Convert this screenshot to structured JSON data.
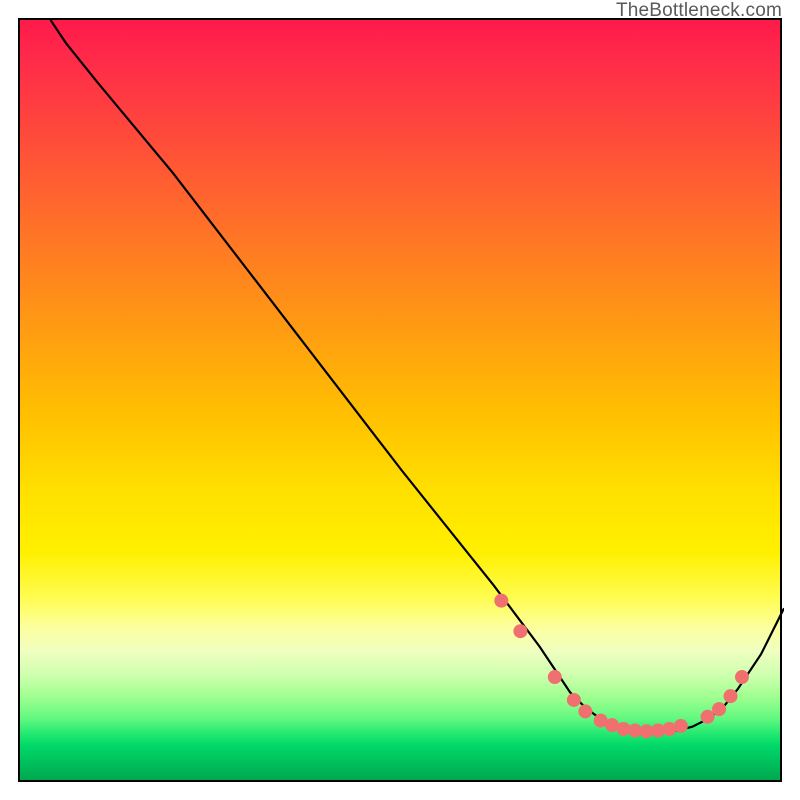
{
  "watermark": "TheBottleneck.com",
  "chart_data": {
    "type": "line",
    "title": "",
    "xlabel": "",
    "ylabel": "",
    "xlim": [
      0,
      100
    ],
    "ylim": [
      0,
      100
    ],
    "series": [
      {
        "name": "curve",
        "x": [
          4,
          6,
          10,
          20,
          30,
          40,
          50,
          58,
          62,
          65,
          68,
          70,
          72,
          74,
          76,
          78,
          80,
          82,
          84,
          86,
          88,
          90,
          92,
          94,
          97,
          100
        ],
        "values": [
          100,
          97,
          92,
          80,
          67,
          54,
          41,
          31,
          26,
          22,
          18,
          15,
          12,
          10,
          8.5,
          7.5,
          7,
          6.8,
          6.8,
          7,
          7.5,
          8.5,
          10,
          12.5,
          17,
          23
        ]
      }
    ],
    "markers": [
      {
        "x": 63,
        "y": 24
      },
      {
        "x": 65.5,
        "y": 20
      },
      {
        "x": 70,
        "y": 14
      },
      {
        "x": 72.5,
        "y": 11
      },
      {
        "x": 74,
        "y": 9.5
      },
      {
        "x": 76,
        "y": 8.3
      },
      {
        "x": 77.5,
        "y": 7.7
      },
      {
        "x": 79,
        "y": 7.2
      },
      {
        "x": 80.5,
        "y": 7
      },
      {
        "x": 82,
        "y": 6.9
      },
      {
        "x": 83.5,
        "y": 7
      },
      {
        "x": 85,
        "y": 7.2
      },
      {
        "x": 86.5,
        "y": 7.6
      },
      {
        "x": 90,
        "y": 8.8
      },
      {
        "x": 91.5,
        "y": 9.8
      },
      {
        "x": 93,
        "y": 11.5
      },
      {
        "x": 94.5,
        "y": 14
      }
    ],
    "marker_color": "#f07070",
    "curve_color": "#000000"
  }
}
